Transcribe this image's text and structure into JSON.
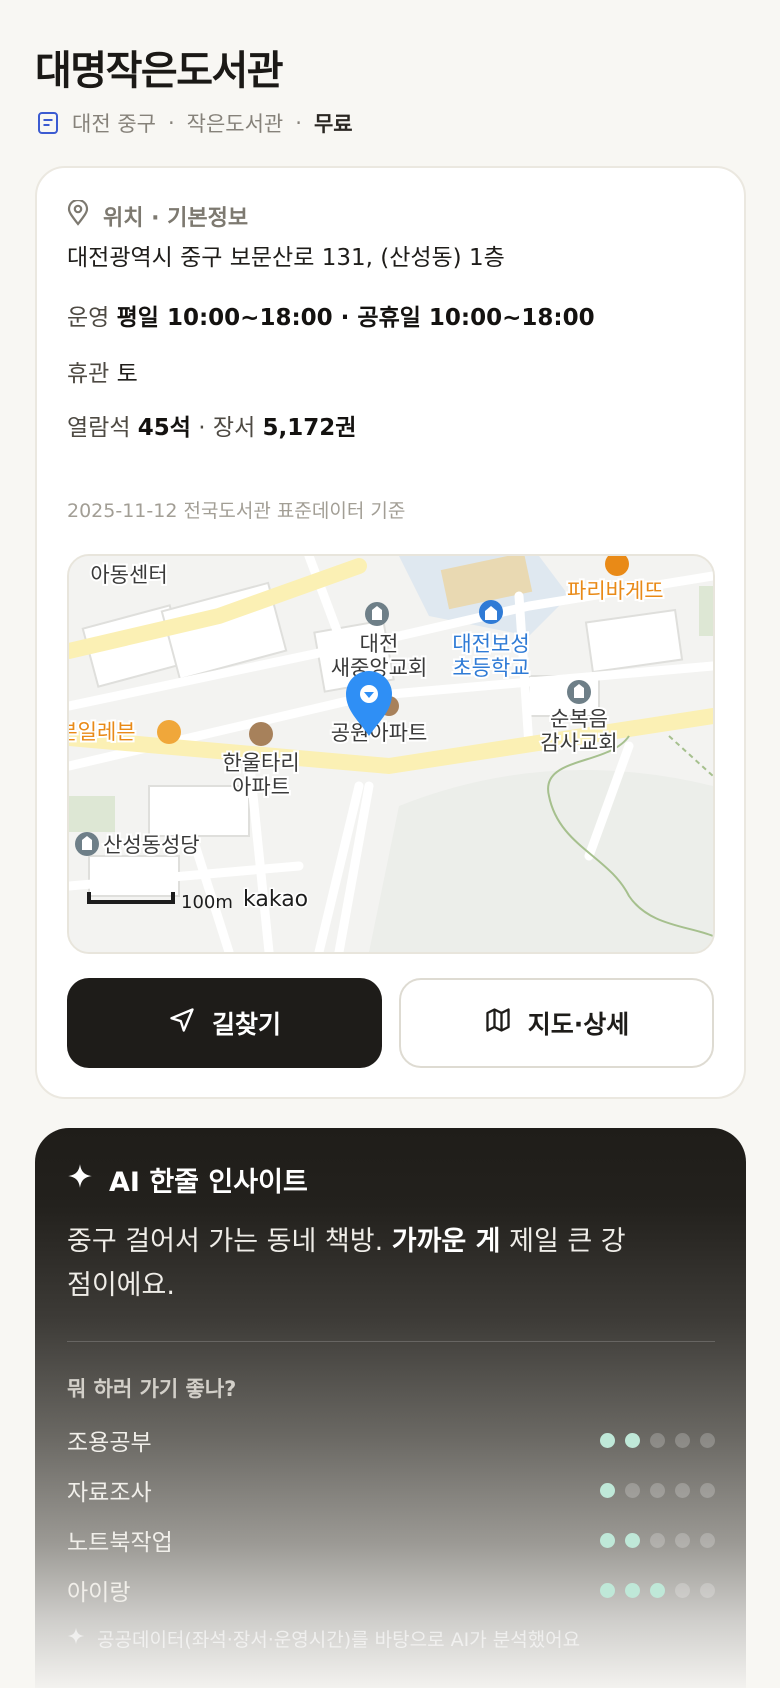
{
  "page": {
    "title": "대명작은도서관",
    "subtitle_region": "대전 중구",
    "subtitle_type": "작은도서관",
    "subtitle_separator": "·",
    "subtitle_fee": "무료"
  },
  "info": {
    "section_title": "위치 · 기본정보",
    "address": "대전광역시 중구 보문산로 131, (산성동) 1층",
    "hours_label": "운영",
    "hours_value": "평일 10:00~18:00 · 공휴일 10:00~18:00",
    "closed_label": "휴관",
    "closed_value": "토",
    "seats_label": "열람석",
    "seats_value": "45석",
    "books_sep": "·",
    "books_label": "장서",
    "books_value": "5,172권",
    "data_note": "2025-11-12 전국도서관 표준데이터 기준"
  },
  "map": {
    "labels": {
      "center": "아동센터",
      "church_a_1": "대전",
      "church_a_2": "새중앙교회",
      "school_1": "대전보성",
      "school_2": "초등학교",
      "bakery": "파리바게뜨",
      "church_b_1": "순복음",
      "church_b_2": "감사교회",
      "store": "세븐일레븐",
      "apt_a_1": "한울타리",
      "apt_a_2": "아파트",
      "apt_b": "공원아파트",
      "cathedral": "산성동성당",
      "scale": "100m",
      "brand": "kakao"
    },
    "colors": {
      "road_main": "#fbf0b4",
      "marker": "#2f8ff5",
      "school_text": "#2f7bd6",
      "poi_orange": "#e98a17"
    }
  },
  "actions": {
    "directions_label": "길찾기",
    "map_detail_label": "지도·상세"
  },
  "ai": {
    "title": "AI 한줄 인사이트",
    "text_before": "중구 걸어서 가는 동네 책방. ",
    "text_bold": "가까운 게",
    "text_after": " 제일 큰 강점이에요.",
    "question": "뭐 하러 가기 좋나?",
    "scores": [
      {
        "label": "조용공부",
        "score": 2,
        "max": 5
      },
      {
        "label": "자료조사",
        "score": 1,
        "max": 5
      },
      {
        "label": "노트북작업",
        "score": 2,
        "max": 5
      },
      {
        "label": "아이랑",
        "score": 3,
        "max": 5
      }
    ],
    "footnote": "공공데이터(좌석·장서·운영시간)를 바탕으로 AI가 분석했어요",
    "colors": {
      "dot_on": "#bfe8d8"
    }
  }
}
